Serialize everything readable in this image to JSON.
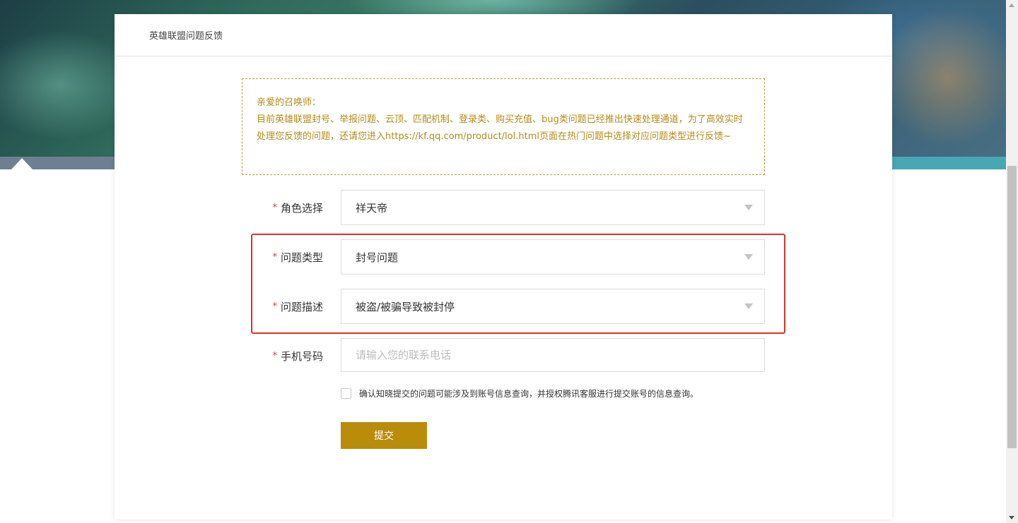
{
  "header": {
    "title": "英雄联盟问题反馈"
  },
  "notice": {
    "line1": "亲爱的召唤师：",
    "line2": "目前英雄联盟封号、举报问题、云顶、匹配机制、登录类、购买充值、bug类问题已经推出快速处理通道，为了高效实时处理您反馈的问题，还请您进入https://kf.qq.com/product/lol.html页面在热门问题中选择对应问题类型进行反馈~"
  },
  "form": {
    "required_mark": "*",
    "role": {
      "label": "角色选择",
      "value": "祥天帝"
    },
    "issue_type": {
      "label": "问题类型",
      "value": "封号问题"
    },
    "issue_desc": {
      "label": "问题描述",
      "value": "被盗/被骗导致被封停"
    },
    "phone": {
      "label": "手机号码",
      "placeholder": "请输入您的联系电话",
      "value": ""
    },
    "consent": {
      "text": "确认知晓提交的问题可能涉及到账号信息查询，并授权腾讯客服进行提交账号的信息查询。",
      "checked": false
    },
    "submit_label": "提交"
  },
  "colors": {
    "accent": "#b98c0a",
    "notice_text": "#b48b16",
    "required": "#e23a2e",
    "highlight": "#e0302a"
  }
}
